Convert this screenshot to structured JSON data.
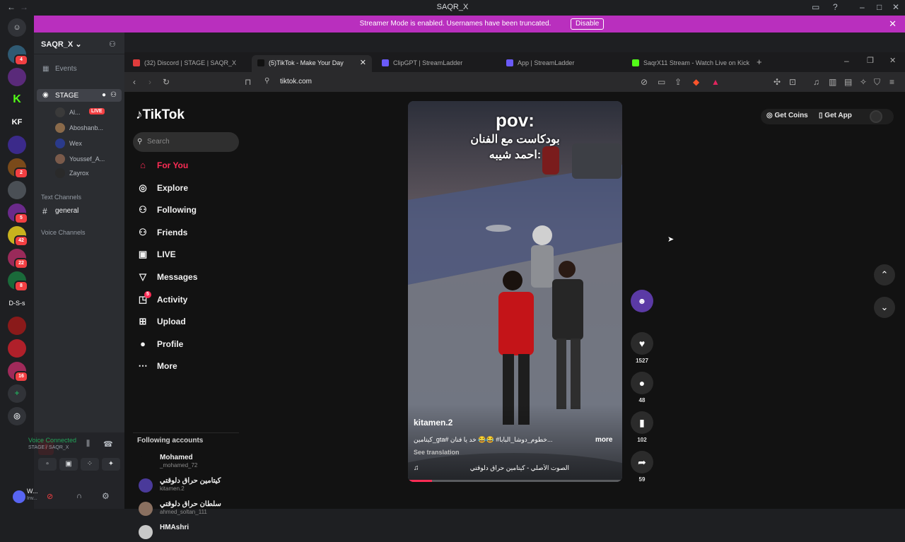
{
  "window": {
    "title": "SAQR_X"
  },
  "banner": {
    "text": "Streamer Mode is enabled. Usernames have been truncated.",
    "button": "Disable"
  },
  "rail": {
    "servers": [
      {
        "label": "",
        "badge": "4",
        "color": "#2f5a73"
      },
      {
        "label": "",
        "badge": "",
        "color": "#5a2a7a"
      },
      {
        "label": "K",
        "badge": "",
        "color": "#1e1f22"
      },
      {
        "label": "KF",
        "badge": "",
        "color": "#1e1f22"
      },
      {
        "label": "",
        "badge": "",
        "color": "#3b2a8a"
      },
      {
        "label": "",
        "badge": "2",
        "color": "#7a4a1a"
      },
      {
        "label": "",
        "badge": "",
        "color": "#4a4f55"
      },
      {
        "label": "",
        "badge": "5",
        "color": "#6a2a8a"
      },
      {
        "label": "",
        "badge": "42",
        "color": "#c8b21e"
      },
      {
        "label": "",
        "badge": "22",
        "color": "#9a2a5a"
      },
      {
        "label": "",
        "badge": "8",
        "color": "#1a6a3a"
      },
      {
        "label": "D-S-s",
        "badge": "",
        "color": "#1e1f22"
      },
      {
        "label": "",
        "badge": "",
        "color": "#8a1a1a"
      },
      {
        "label": "",
        "badge": "",
        "color": "#b0202a"
      },
      {
        "label": "",
        "badge": "16",
        "color": "#a02a5a"
      }
    ]
  },
  "sidebar": {
    "server_name": "SAQR_X",
    "events": "Events",
    "stage": "STAGE",
    "voice_users": [
      {
        "name": "Al...",
        "live": "LIVE",
        "color": "#3a3a3a"
      },
      {
        "name": "Aboshanb...",
        "live": "",
        "color": "#8a6a4a"
      },
      {
        "name": "Wex",
        "live": "",
        "color": "#2a3a8a"
      },
      {
        "name": "Youssef_A...",
        "live": "",
        "color": "#7a5a4a"
      },
      {
        "name": "Zayrox",
        "live": "",
        "color": "#2a2a2a"
      }
    ],
    "text_channels": "Text Channels",
    "general": "general",
    "voice_channels": "Voice Channels",
    "voice_connected": "Voice Connected",
    "voice_location": "STAGE / SAQR_X",
    "user_name": "W...",
    "user_status": "Inv..."
  },
  "browser": {
    "tabs": [
      {
        "label": "(32) Discord | STAGE | SAQR_X",
        "color": "#e03c3c"
      },
      {
        "label": "(5)TikTok - Make Your Day",
        "color": "#111111"
      },
      {
        "label": "ClipGPT | StreamLadder",
        "color": "#6a5af9"
      },
      {
        "label": "App | StreamLadder",
        "color": "#6a5af9"
      },
      {
        "label": "SaqrX11 Stream - Watch Live on Kick",
        "color": "#53fc18"
      }
    ],
    "url": "tiktok.com"
  },
  "tiktok": {
    "logo": "TikTok",
    "search_placeholder": "Search",
    "nav": [
      "For You",
      "Explore",
      "Following",
      "Friends",
      "LIVE",
      "Messages",
      "Activity",
      "Upload",
      "Profile",
      "More"
    ],
    "activity_badge": "5",
    "following_title": "Following accounts",
    "following": [
      {
        "name": "Mohamed",
        "handle": "_mohamed_72"
      },
      {
        "name": "كيتامين حراق دلوقتي",
        "handle": "kitamen.2"
      },
      {
        "name": "سلطان حراق دلوقتي",
        "handle": "ahmed_soltan_111"
      },
      {
        "name": "HMAshri",
        "handle": ""
      }
    ],
    "get_coins": "Get Coins",
    "get_app": "Get App",
    "video": {
      "overlay_pov": "pov:",
      "overlay_line1": "بودكاست مع الفنان",
      "overlay_line2": "احمد شيبه:",
      "author": "kitamen.2",
      "caption": "كيتامين_gta# خطوم_دوشا_البابا# 😂😂 خد يا فنان...",
      "more": "more",
      "see_translation": "See translation",
      "sound": "الصوت الأصلي - كيتامين حراق دلوقتي"
    },
    "likes": "1527",
    "comments": "48",
    "saves": "102",
    "shares": "59"
  }
}
